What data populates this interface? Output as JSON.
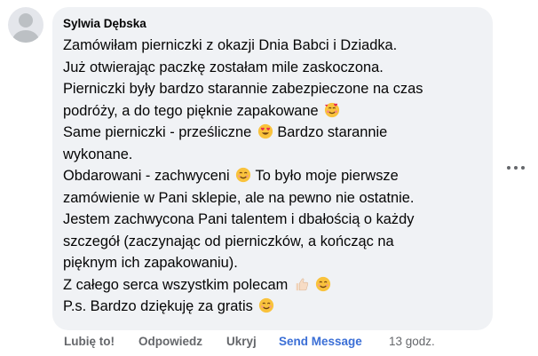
{
  "comment": {
    "author": "Sylwia Dębska",
    "lines": [
      "Zamówiłam pierniczki z okazji Dnia Babci i Dziadka.",
      "Już otwierając paczkę zostałam mile zaskoczona.",
      "Pierniczki były bardzo starannie zabezpieczone na czas",
      "podróży, a do tego pięknie zapakowane",
      "Same pierniczki - prześliczne",
      " Bardzo starannie",
      "wykonane.",
      "Obdarowani - zachwyceni",
      " To było moje pierwsze",
      "zamówienie w Pani sklepie, ale na pewno nie ostatnie.",
      "Jestem zachwycona Pani talentem i dbałością o każdy",
      "szczegół (zaczynając od pierniczków, a kończąc na",
      "pięknym ich zapakowaniu).",
      "Z całego serca wszystkim polecam",
      "P.s. Bardzo dziękuję za gratis"
    ],
    "emojis": {
      "hearts_face": "smiling-face-with-hearts",
      "heart_eyes": "heart-eyes",
      "smile": "smiling-face",
      "thumbs_up": "thumbs-up"
    }
  },
  "actions": {
    "like": "Lubię to!",
    "reply": "Odpowiedz",
    "hide": "Ukryj",
    "send_message": "Send Message",
    "time": "13 godz."
  },
  "colors": {
    "bubble": "#f0f2f5",
    "link": "#3b6fd6",
    "muted": "#65676b"
  }
}
